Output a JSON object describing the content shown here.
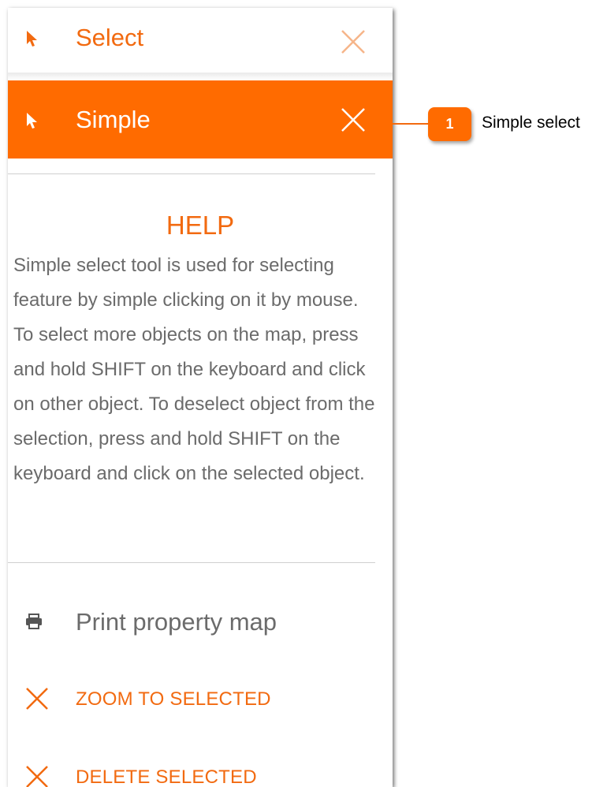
{
  "panel": {
    "select_row": {
      "label": "Select",
      "cursor_icon": "pointer-icon",
      "close_icon": "close-icon"
    },
    "simple_row": {
      "label": "Simple",
      "cursor_icon": "pointer-icon",
      "close_icon": "close-icon"
    },
    "help": {
      "title": "HELP",
      "text": "Simple select tool is used for selecting feature by simple clicking on it by mouse. To select more objects on the map, press and hold SHIFT on the keyboard and click on other object. To deselect object from the selection, press and hold SHIFT on the keyboard and click on the selected object."
    },
    "print": {
      "label": "Print property map",
      "icon": "printer-icon"
    },
    "actions": [
      {
        "label": "ZOOM TO SELECTED",
        "icon": "close-icon"
      },
      {
        "label": "DELETE SELECTED",
        "icon": "close-icon"
      }
    ]
  },
  "callout": {
    "number": "1",
    "text": "Simple select"
  },
  "colors": {
    "accent": "#ff6b00",
    "accent_text": "#f26a10",
    "body_text": "#6b6b6b"
  }
}
